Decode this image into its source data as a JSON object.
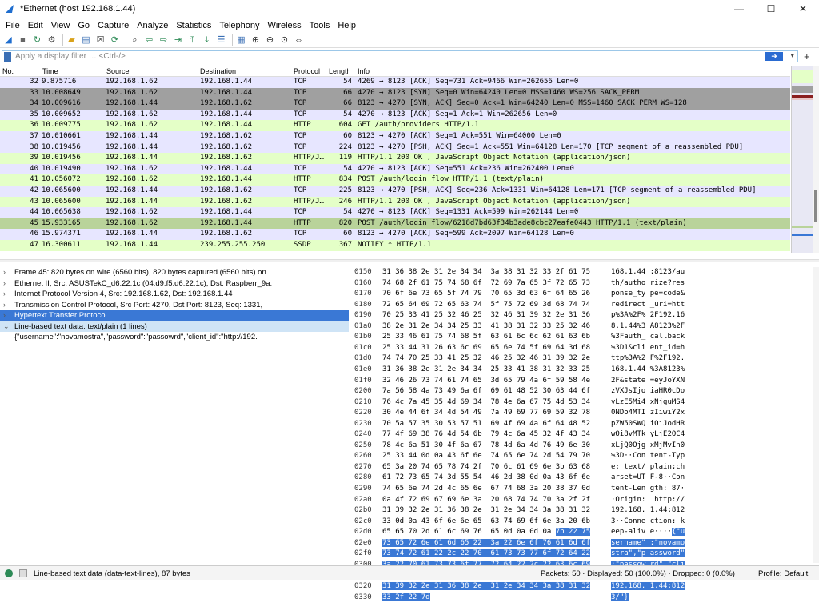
{
  "window": {
    "title": "*Ethernet (host 192.168.1.44)",
    "minimize": "—",
    "maximize": "☐",
    "close": "✕"
  },
  "menu": [
    "File",
    "Edit",
    "View",
    "Go",
    "Capture",
    "Analyze",
    "Statistics",
    "Telephony",
    "Wireless",
    "Tools",
    "Help"
  ],
  "toolbar": {
    "icons": [
      "shark-fin-start-icon",
      "stop-icon",
      "restart-icon",
      "options-gear-icon",
      "open-folder-icon",
      "save-icon",
      "close-file-icon",
      "reload-icon",
      "find-icon",
      "back-icon",
      "forward-icon",
      "goto-icon",
      "first-icon",
      "last-icon",
      "autoscroll-icon",
      "colorize-icon",
      "zoom-in-icon",
      "zoom-out-icon",
      "zoom-normal-icon",
      "resize-columns-icon"
    ]
  },
  "filter": {
    "placeholder": "Apply a display filter … <Ctrl-/>",
    "apply": "➜",
    "dropdown": "▾",
    "add": "+"
  },
  "columns": {
    "no": "No.",
    "time": "Time",
    "source": "Source",
    "destination": "Destination",
    "protocol": "Protocol",
    "length": "Length",
    "info": "Info"
  },
  "packets": [
    {
      "no": "32",
      "time": "9.875716",
      "src": "192.168.1.62",
      "dst": "192.168.1.44",
      "proto": "TCP",
      "len": "54",
      "info": "4269 → 8123 [ACK] Seq=731 Ack=9466 Win=262656 Len=0",
      "style": "tcp"
    },
    {
      "no": "33",
      "time": "10.008649",
      "src": "192.168.1.62",
      "dst": "192.168.1.44",
      "proto": "TCP",
      "len": "66",
      "info": "4270 → 8123 [SYN] Seq=0 Win=64240 Len=0 MSS=1460 WS=256 SACK_PERM",
      "style": "dark"
    },
    {
      "no": "34",
      "time": "10.009616",
      "src": "192.168.1.44",
      "dst": "192.168.1.62",
      "proto": "TCP",
      "len": "66",
      "info": "8123 → 4270 [SYN, ACK] Seq=0 Ack=1 Win=64240 Len=0 MSS=1460 SACK_PERM WS=128",
      "style": "dark"
    },
    {
      "no": "35",
      "time": "10.009652",
      "src": "192.168.1.62",
      "dst": "192.168.1.44",
      "proto": "TCP",
      "len": "54",
      "info": "4270 → 8123 [ACK] Seq=1 Ack=1 Win=262656 Len=0",
      "style": "tcp"
    },
    {
      "no": "36",
      "time": "10.009775",
      "src": "192.168.1.62",
      "dst": "192.168.1.44",
      "proto": "HTTP",
      "len": "604",
      "info": "GET /auth/providers HTTP/1.1",
      "style": "http"
    },
    {
      "no": "37",
      "time": "10.010661",
      "src": "192.168.1.44",
      "dst": "192.168.1.62",
      "proto": "TCP",
      "len": "60",
      "info": "8123 → 4270 [ACK] Seq=1 Ack=551 Win=64000 Len=0",
      "style": "tcp"
    },
    {
      "no": "38",
      "time": "10.019456",
      "src": "192.168.1.44",
      "dst": "192.168.1.62",
      "proto": "TCP",
      "len": "224",
      "info": "8123 → 4270 [PSH, ACK] Seq=1 Ack=551 Win=64128 Len=170 [TCP segment of a reassembled PDU]",
      "style": "tcp"
    },
    {
      "no": "39",
      "time": "10.019456",
      "src": "192.168.1.44",
      "dst": "192.168.1.62",
      "proto": "HTTP/J…",
      "len": "119",
      "info": "HTTP/1.1 200 OK , JavaScript Object Notation (application/json)",
      "style": "http"
    },
    {
      "no": "40",
      "time": "10.019490",
      "src": "192.168.1.62",
      "dst": "192.168.1.44",
      "proto": "TCP",
      "len": "54",
      "info": "4270 → 8123 [ACK] Seq=551 Ack=236 Win=262400 Len=0",
      "style": "tcp"
    },
    {
      "no": "41",
      "time": "10.056072",
      "src": "192.168.1.62",
      "dst": "192.168.1.44",
      "proto": "HTTP",
      "len": "834",
      "info": "POST /auth/login_flow HTTP/1.1  (text/plain)",
      "style": "http"
    },
    {
      "no": "42",
      "time": "10.065600",
      "src": "192.168.1.44",
      "dst": "192.168.1.62",
      "proto": "TCP",
      "len": "225",
      "info": "8123 → 4270 [PSH, ACK] Seq=236 Ack=1331 Win=64128 Len=171 [TCP segment of a reassembled PDU]",
      "style": "tcp"
    },
    {
      "no": "43",
      "time": "10.065600",
      "src": "192.168.1.44",
      "dst": "192.168.1.62",
      "proto": "HTTP/J…",
      "len": "246",
      "info": "HTTP/1.1 200 OK , JavaScript Object Notation (application/json)",
      "style": "http"
    },
    {
      "no": "44",
      "time": "10.065638",
      "src": "192.168.1.62",
      "dst": "192.168.1.44",
      "proto": "TCP",
      "len": "54",
      "info": "4270 → 8123 [ACK] Seq=1331 Ack=599 Win=262144 Len=0",
      "style": "tcp"
    },
    {
      "no": "45",
      "time": "15.933165",
      "src": "192.168.1.62",
      "dst": "192.168.1.44",
      "proto": "HTTP",
      "len": "820",
      "info": "POST /auth/login_flow/6218d7bd63f34b3ade8cbc27eafe0443 HTTP/1.1  (text/plain)",
      "style": "sel"
    },
    {
      "no": "46",
      "time": "15.974371",
      "src": "192.168.1.44",
      "dst": "192.168.1.62",
      "proto": "TCP",
      "len": "60",
      "info": "8123 → 4270 [ACK] Seq=599 Ack=2097 Win=64128 Len=0",
      "style": "tcp"
    },
    {
      "no": "47",
      "time": "16.300611",
      "src": "192.168.1.44",
      "dst": "239.255.255.250",
      "proto": "SSDP",
      "len": "367",
      "info": "NOTIFY * HTTP/1.1",
      "style": "http"
    }
  ],
  "details": [
    {
      "arrow": "›",
      "text": "Frame 45: 820 bytes on wire (6560 bits), 820 bytes captured (6560 bits) on",
      "style": ""
    },
    {
      "arrow": "›",
      "text": "Ethernet II, Src: ASUSTekC_d6:22:1c (04:d9:f5:d6:22:1c), Dst: Raspberr_9a:",
      "style": ""
    },
    {
      "arrow": "›",
      "text": "Internet Protocol Version 4, Src: 192.168.1.62, Dst: 192.168.1.44",
      "style": ""
    },
    {
      "arrow": "›",
      "text": "Transmission Control Protocol, Src Port: 4270, Dst Port: 8123, Seq: 1331,",
      "style": ""
    },
    {
      "arrow": "›",
      "text": "Hypertext Transfer Protocol",
      "style": "sel"
    },
    {
      "arrow": "⌄",
      "text": "Line-based text data: text/plain (1 lines)",
      "style": "hl"
    },
    {
      "arrow": "",
      "text": "   {\"username\":\"novamostra\",\"password\":\"passowrd\",\"client_id\":\"http://192.",
      "style": ""
    }
  ],
  "hex": [
    {
      "off": "0150",
      "hex": "31 36 38 2e 31 2e 34 34  3a 38 31 32 33 2f 61 75",
      "asc": "168.1.44 :8123/au"
    },
    {
      "off": "0160",
      "hex": "74 68 2f 61 75 74 68 6f  72 69 7a 65 3f 72 65 73",
      "asc": "th/autho rize?res"
    },
    {
      "off": "0170",
      "hex": "70 6f 6e 73 65 5f 74 79  70 65 3d 63 6f 64 65 26",
      "asc": "ponse_ty pe=code&"
    },
    {
      "off": "0180",
      "hex": "72 65 64 69 72 65 63 74  5f 75 72 69 3d 68 74 74",
      "asc": "redirect _uri=htt"
    },
    {
      "off": "0190",
      "hex": "70 25 33 41 25 32 46 25  32 46 31 39 32 2e 31 36",
      "asc": "p%3A%2F% 2F192.16"
    },
    {
      "off": "01a0",
      "hex": "38 2e 31 2e 34 34 25 33  41 38 31 32 33 25 32 46",
      "asc": "8.1.44%3 A8123%2F"
    },
    {
      "off": "01b0",
      "hex": "25 33 46 61 75 74 68 5f  63 61 6c 6c 62 61 63 6b",
      "asc": "%3Fauth_ callback"
    },
    {
      "off": "01c0",
      "hex": "25 33 44 31 26 63 6c 69  65 6e 74 5f 69 64 3d 68",
      "asc": "%3D1&cli ent_id=h"
    },
    {
      "off": "01d0",
      "hex": "74 74 70 25 33 41 25 32  46 25 32 46 31 39 32 2e",
      "asc": "ttp%3A%2 F%2F192."
    },
    {
      "off": "01e0",
      "hex": "31 36 38 2e 31 2e 34 34  25 33 41 38 31 32 33 25",
      "asc": "168.1.44 %3A8123%"
    },
    {
      "off": "01f0",
      "hex": "32 46 26 73 74 61 74 65  3d 65 79 4a 6f 59 58 4e",
      "asc": "2F&state =eyJoYXN"
    },
    {
      "off": "0200",
      "hex": "7a 56 58 4a 73 49 6a 6f  69 61 48 52 30 63 44 6f",
      "asc": "zVXJsIjo iaHR0cDo"
    },
    {
      "off": "0210",
      "hex": "76 4c 7a 45 35 4d 69 34  78 4e 6a 67 75 4d 53 34",
      "asc": "vLzE5Mi4 xNjguMS4"
    },
    {
      "off": "0220",
      "hex": "30 4e 44 6f 34 4d 54 49  7a 49 69 77 69 59 32 78",
      "asc": "0NDo4MTI zIiwiY2x"
    },
    {
      "off": "0230",
      "hex": "70 5a 57 35 30 53 57 51  69 4f 69 4a 6f 64 48 52",
      "asc": "pZW50SWQ iOiJodHR"
    },
    {
      "off": "0240",
      "hex": "77 4f 69 38 76 4d 54 6b  79 4c 6a 45 32 4f 43 34",
      "asc": "wOi8vMTk yLjE2OC4"
    },
    {
      "off": "0250",
      "hex": "78 4c 6a 51 30 4f 6a 67  78 4d 6a 4d 76 49 6e 30",
      "asc": "xLjQ0Ojg xMjMvIn0"
    },
    {
      "off": "0260",
      "hex": "25 33 44 0d 0a 43 6f 6e  74 65 6e 74 2d 54 79 70",
      "asc": "%3D··Con tent-Typ"
    },
    {
      "off": "0270",
      "hex": "65 3a 20 74 65 78 74 2f  70 6c 61 69 6e 3b 63 68",
      "asc": "e: text/ plain;ch"
    },
    {
      "off": "0280",
      "hex": "61 72 73 65 74 3d 55 54  46 2d 38 0d 0a 43 6f 6e",
      "asc": "arset=UT F-8··Con"
    },
    {
      "off": "0290",
      "hex": "74 65 6e 74 2d 4c 65 6e  67 74 68 3a 20 38 37 0d",
      "asc": "tent-Len gth: 87·"
    },
    {
      "off": "02a0",
      "hex": "0a 4f 72 69 67 69 6e 3a  20 68 74 74 70 3a 2f 2f",
      "asc": "·Origin:  http://"
    },
    {
      "off": "02b0",
      "hex": "31 39 32 2e 31 36 38 2e  31 2e 34 34 3a 38 31 32",
      "asc": "192.168. 1.44:812"
    },
    {
      "off": "02c0",
      "hex": "33 0d 0a 43 6f 6e 6e 65  63 74 69 6f 6e 3a 20 6b",
      "asc": "3··Conne ction: k"
    },
    {
      "off": "02d0",
      "hex": "65 65 70 2d 61 6c 69 76  65 0d 0a 0d 0a ",
      "hexsel": "7b 22 75",
      "asc": "eep-aliv e····",
      "ascsel": "{\"u"
    },
    {
      "off": "02e0",
      "hex": "",
      "hexsel": "73 65 72 6e 61 6d 65 22  3a 22 6e 6f 76 61 6d 6f",
      "asc": "",
      "ascsel": "sername\" :\"novamo"
    },
    {
      "off": "02f0",
      "hex": "",
      "hexsel": "73 74 72 61 22 2c 22 70  61 73 73 77 6f 72 64 22",
      "asc": "",
      "ascsel": "stra\",\"p assword\""
    },
    {
      "off": "0300",
      "hex": "",
      "hexsel": "3a 22 70 61 73 73 6f 77  72 64 22 2c 22 63 6c 69",
      "asc": "",
      "ascsel": ":\"passow rd\",\"cli"
    },
    {
      "off": "0310",
      "hex": "",
      "hexsel": "65 6e 74 5f 69 64 22 3a  22 68 74 74 70 3a 2f 2f",
      "asc": "",
      "ascsel": "ent_id\": \"http://"
    },
    {
      "off": "0320",
      "hex": "",
      "hexsel": "31 39 32 2e 31 36 38 2e  31 2e 34 34 3a 38 31 32",
      "asc": "",
      "ascsel": "192.168. 1.44:812"
    },
    {
      "off": "0330",
      "hex": "",
      "hexsel": "33 2f 22 7d",
      "asc": "",
      "ascsel": "3/\"}"
    }
  ],
  "status": {
    "left": "Line-based text data (data-text-lines), 87 bytes",
    "packets": "Packets: 50 · Displayed: 50 (100.0%) · Dropped: 0 (0.0%)",
    "profile": "Profile: Default"
  }
}
